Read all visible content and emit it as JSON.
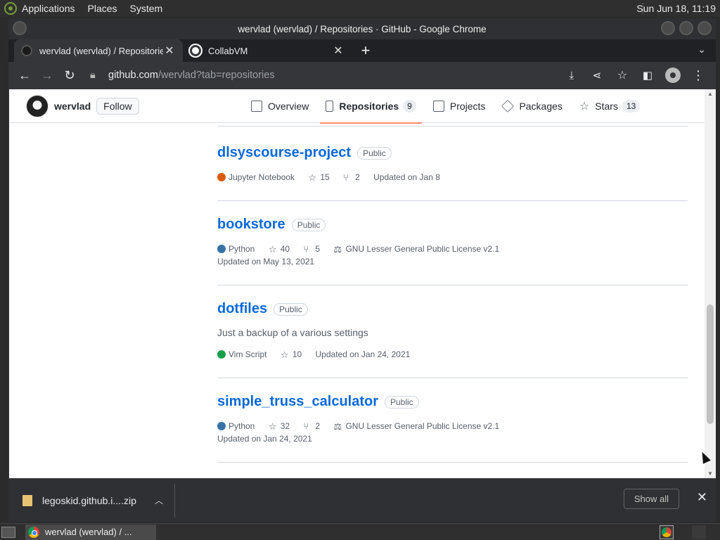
{
  "top_panel": {
    "menus": [
      "Applications",
      "Places",
      "System"
    ],
    "clock": "Sun Jun 18, 11:19"
  },
  "window": {
    "title": "wervlad (wervlad) / Repositories · GitHub - Google Chrome"
  },
  "tabs": [
    {
      "title": "wervlad (wervlad) / Repositories",
      "active": true,
      "favicon": "github-icon"
    },
    {
      "title": "CollabVM",
      "active": false,
      "favicon": "collabvm-icon"
    }
  ],
  "omnibox": {
    "host": "github.com",
    "path": "/wervlad?tab=repositories"
  },
  "github": {
    "username": "wervlad",
    "follow_label": "Follow",
    "nav": [
      {
        "label": "Overview",
        "icon": "book-icon",
        "count": null,
        "active": false
      },
      {
        "label": "Repositories",
        "icon": "repo-icon",
        "count": "9",
        "active": true
      },
      {
        "label": "Projects",
        "icon": "table-icon",
        "count": null,
        "active": false
      },
      {
        "label": "Packages",
        "icon": "package-icon",
        "count": null,
        "active": false
      },
      {
        "label": "Stars",
        "icon": "star-icon",
        "count": "13",
        "active": false
      }
    ],
    "repos": [
      {
        "name": "dlsyscourse-project",
        "visibility": "Public",
        "description": "",
        "language": "Jupyter Notebook",
        "language_color": "#DA5B0B",
        "stars": "15",
        "forks": "2",
        "license": "",
        "updated": "Updated on Jan 8"
      },
      {
        "name": "bookstore",
        "visibility": "Public",
        "description": "",
        "language": "Python",
        "language_color": "#3572A5",
        "stars": "40",
        "forks": "5",
        "license": "GNU Lesser General Public License v2.1",
        "updated": "Updated on May 13, 2021"
      },
      {
        "name": "dotfiles",
        "visibility": "Public",
        "description": "Just a backup of a various settings",
        "language": "Vim Script",
        "language_color": "#199F4B",
        "stars": "10",
        "forks": "",
        "license": "",
        "updated": "Updated on Jan 24, 2021"
      },
      {
        "name": "simple_truss_calculator",
        "visibility": "Public",
        "description": "",
        "language": "Python",
        "language_color": "#3572A5",
        "stars": "32",
        "forks": "2",
        "license": "GNU Lesser General Public License v2.1",
        "updated": "Updated on Jan 24, 2021"
      }
    ]
  },
  "download_shelf": {
    "file_name": "legoskid.github.i....zip",
    "show_all_label": "Show all"
  },
  "taskbar": {
    "task_label": "wervlad (wervlad) / ..."
  },
  "colors": {
    "link": "#0969da",
    "tab_underline": "#fd8c73"
  }
}
